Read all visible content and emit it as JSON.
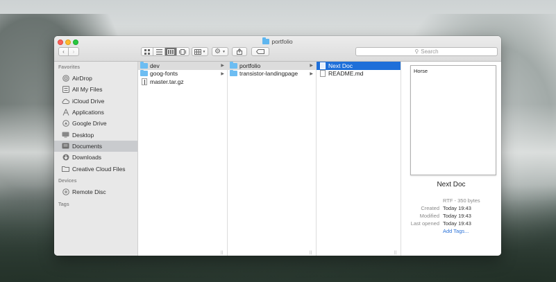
{
  "window": {
    "title": "portfolio"
  },
  "toolbar": {
    "back_icon": "chevron-left-icon",
    "forward_icon": "chevron-right-icon",
    "view_modes": [
      "icon-view-icon",
      "list-view-icon",
      "column-view-icon",
      "cover-flow-icon"
    ],
    "active_view": "column-view-icon",
    "search_placeholder": "Search"
  },
  "sidebar": {
    "favorites_header": "Favorites",
    "favorites": [
      {
        "label": "AirDrop",
        "icon": "airdrop-icon"
      },
      {
        "label": "All My Files",
        "icon": "all-files-icon"
      },
      {
        "label": "iCloud Drive",
        "icon": "cloud-icon"
      },
      {
        "label": "Applications",
        "icon": "applications-icon"
      },
      {
        "label": "Google Drive",
        "icon": "google-drive-icon"
      },
      {
        "label": "Desktop",
        "icon": "desktop-icon"
      },
      {
        "label": "Documents",
        "icon": "documents-icon",
        "selected": true
      },
      {
        "label": "Downloads",
        "icon": "downloads-icon"
      },
      {
        "label": "Creative Cloud Files",
        "icon": "folder-icon"
      }
    ],
    "devices_header": "Devices",
    "devices": [
      {
        "label": "Remote Disc",
        "icon": "disc-icon"
      }
    ],
    "tags_header": "Tags"
  },
  "columns": [
    {
      "items": [
        {
          "label": "dev",
          "kind": "folder",
          "state": "highlighted"
        },
        {
          "label": "goog-fonts",
          "kind": "folder"
        },
        {
          "label": "master.tar.gz",
          "kind": "archive"
        }
      ]
    },
    {
      "items": [
        {
          "label": "portfolio",
          "kind": "folder",
          "state": "highlighted"
        },
        {
          "label": "transistor-landingpage",
          "kind": "folder"
        }
      ]
    },
    {
      "items": [
        {
          "label": "Next Doc",
          "kind": "document",
          "state": "selected"
        },
        {
          "label": "README.md",
          "kind": "document"
        }
      ]
    }
  ],
  "preview": {
    "content": "Horse",
    "name": "Next Doc",
    "kind": "RTF - 350 bytes",
    "created_label": "Created",
    "created": "Today 19:43",
    "modified_label": "Modified",
    "modified": "Today 19:43",
    "last_opened_label": "Last opened",
    "last_opened": "Today 19:43",
    "add_tags": "Add Tags..."
  },
  "colors": {
    "selection": "#1e6fd9",
    "folder": "#6dbdf2",
    "link": "#2a72d8"
  }
}
